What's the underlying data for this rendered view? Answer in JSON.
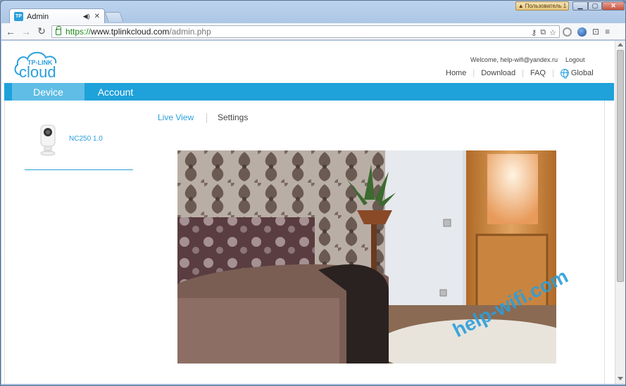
{
  "browser": {
    "tab_title": "Admin",
    "tab_favicon_text": "TP",
    "user_badge": "Пользователь 1",
    "url_scheme": "https://",
    "url_host": "www.tplinkcloud.com",
    "url_path": "/admin.php"
  },
  "header": {
    "logo_top": "TP-LINK",
    "logo_main": "cloud",
    "welcome": "Welcome, help-wifi@yandex.ru",
    "logout": "Logout",
    "links": [
      "Home",
      "Download",
      "FAQ",
      "Global"
    ]
  },
  "nav": {
    "device": "Device",
    "account": "Account"
  },
  "device": {
    "name": "NC250 1.0"
  },
  "view_tabs": {
    "live": "Live View",
    "settings": "Settings"
  },
  "watermark": "help-wifi.com",
  "colors": {
    "accent": "#1fa1da",
    "accent_light": "#5fbde6"
  }
}
